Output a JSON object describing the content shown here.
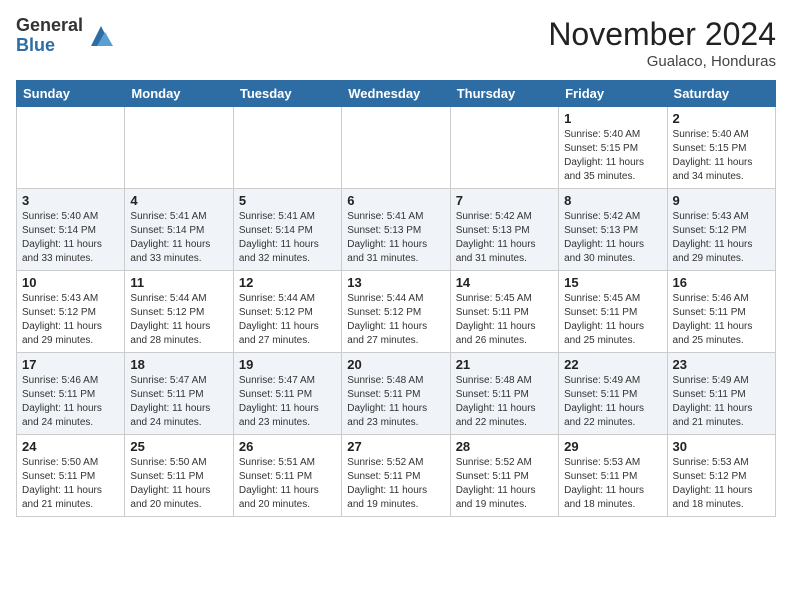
{
  "logo": {
    "general": "General",
    "blue": "Blue"
  },
  "title": "November 2024",
  "location": "Gualaco, Honduras",
  "days_of_week": [
    "Sunday",
    "Monday",
    "Tuesday",
    "Wednesday",
    "Thursday",
    "Friday",
    "Saturday"
  ],
  "weeks": [
    [
      {
        "day": "",
        "info": ""
      },
      {
        "day": "",
        "info": ""
      },
      {
        "day": "",
        "info": ""
      },
      {
        "day": "",
        "info": ""
      },
      {
        "day": "",
        "info": ""
      },
      {
        "day": "1",
        "info": "Sunrise: 5:40 AM\nSunset: 5:15 PM\nDaylight: 11 hours\nand 35 minutes."
      },
      {
        "day": "2",
        "info": "Sunrise: 5:40 AM\nSunset: 5:15 PM\nDaylight: 11 hours\nand 34 minutes."
      }
    ],
    [
      {
        "day": "3",
        "info": "Sunrise: 5:40 AM\nSunset: 5:14 PM\nDaylight: 11 hours\nand 33 minutes."
      },
      {
        "day": "4",
        "info": "Sunrise: 5:41 AM\nSunset: 5:14 PM\nDaylight: 11 hours\nand 33 minutes."
      },
      {
        "day": "5",
        "info": "Sunrise: 5:41 AM\nSunset: 5:14 PM\nDaylight: 11 hours\nand 32 minutes."
      },
      {
        "day": "6",
        "info": "Sunrise: 5:41 AM\nSunset: 5:13 PM\nDaylight: 11 hours\nand 31 minutes."
      },
      {
        "day": "7",
        "info": "Sunrise: 5:42 AM\nSunset: 5:13 PM\nDaylight: 11 hours\nand 31 minutes."
      },
      {
        "day": "8",
        "info": "Sunrise: 5:42 AM\nSunset: 5:13 PM\nDaylight: 11 hours\nand 30 minutes."
      },
      {
        "day": "9",
        "info": "Sunrise: 5:43 AM\nSunset: 5:12 PM\nDaylight: 11 hours\nand 29 minutes."
      }
    ],
    [
      {
        "day": "10",
        "info": "Sunrise: 5:43 AM\nSunset: 5:12 PM\nDaylight: 11 hours\nand 29 minutes."
      },
      {
        "day": "11",
        "info": "Sunrise: 5:44 AM\nSunset: 5:12 PM\nDaylight: 11 hours\nand 28 minutes."
      },
      {
        "day": "12",
        "info": "Sunrise: 5:44 AM\nSunset: 5:12 PM\nDaylight: 11 hours\nand 27 minutes."
      },
      {
        "day": "13",
        "info": "Sunrise: 5:44 AM\nSunset: 5:12 PM\nDaylight: 11 hours\nand 27 minutes."
      },
      {
        "day": "14",
        "info": "Sunrise: 5:45 AM\nSunset: 5:11 PM\nDaylight: 11 hours\nand 26 minutes."
      },
      {
        "day": "15",
        "info": "Sunrise: 5:45 AM\nSunset: 5:11 PM\nDaylight: 11 hours\nand 25 minutes."
      },
      {
        "day": "16",
        "info": "Sunrise: 5:46 AM\nSunset: 5:11 PM\nDaylight: 11 hours\nand 25 minutes."
      }
    ],
    [
      {
        "day": "17",
        "info": "Sunrise: 5:46 AM\nSunset: 5:11 PM\nDaylight: 11 hours\nand 24 minutes."
      },
      {
        "day": "18",
        "info": "Sunrise: 5:47 AM\nSunset: 5:11 PM\nDaylight: 11 hours\nand 24 minutes."
      },
      {
        "day": "19",
        "info": "Sunrise: 5:47 AM\nSunset: 5:11 PM\nDaylight: 11 hours\nand 23 minutes."
      },
      {
        "day": "20",
        "info": "Sunrise: 5:48 AM\nSunset: 5:11 PM\nDaylight: 11 hours\nand 23 minutes."
      },
      {
        "day": "21",
        "info": "Sunrise: 5:48 AM\nSunset: 5:11 PM\nDaylight: 11 hours\nand 22 minutes."
      },
      {
        "day": "22",
        "info": "Sunrise: 5:49 AM\nSunset: 5:11 PM\nDaylight: 11 hours\nand 22 minutes."
      },
      {
        "day": "23",
        "info": "Sunrise: 5:49 AM\nSunset: 5:11 PM\nDaylight: 11 hours\nand 21 minutes."
      }
    ],
    [
      {
        "day": "24",
        "info": "Sunrise: 5:50 AM\nSunset: 5:11 PM\nDaylight: 11 hours\nand 21 minutes."
      },
      {
        "day": "25",
        "info": "Sunrise: 5:50 AM\nSunset: 5:11 PM\nDaylight: 11 hours\nand 20 minutes."
      },
      {
        "day": "26",
        "info": "Sunrise: 5:51 AM\nSunset: 5:11 PM\nDaylight: 11 hours\nand 20 minutes."
      },
      {
        "day": "27",
        "info": "Sunrise: 5:52 AM\nSunset: 5:11 PM\nDaylight: 11 hours\nand 19 minutes."
      },
      {
        "day": "28",
        "info": "Sunrise: 5:52 AM\nSunset: 5:11 PM\nDaylight: 11 hours\nand 19 minutes."
      },
      {
        "day": "29",
        "info": "Sunrise: 5:53 AM\nSunset: 5:11 PM\nDaylight: 11 hours\nand 18 minutes."
      },
      {
        "day": "30",
        "info": "Sunrise: 5:53 AM\nSunset: 5:12 PM\nDaylight: 11 hours\nand 18 minutes."
      }
    ]
  ]
}
